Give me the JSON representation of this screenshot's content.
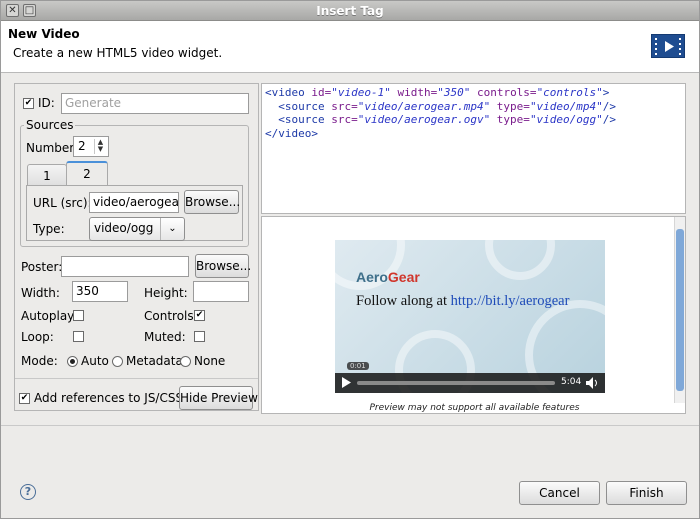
{
  "window": {
    "title": "Insert Tag"
  },
  "header": {
    "title": "New Video",
    "subtitle": "Create a new HTML5 video widget."
  },
  "form": {
    "id_label": "ID:",
    "id_placeholder": "Generate",
    "sources_label": "Sources",
    "number_label": "Number:",
    "number_value": "2",
    "tabs": [
      "1",
      "2"
    ],
    "url_label": "URL (src):",
    "url_value": "video/aerogear.og",
    "browse_label": "Browse...",
    "type_label": "Type:",
    "type_value": "video/ogg",
    "poster_label": "Poster:",
    "poster_browse_label": "Browse...",
    "width_label": "Width:",
    "width_value": "350",
    "height_label": "Height:",
    "height_value": "",
    "autoplay_label": "Autoplay:",
    "controls_label": "Controls:",
    "loop_label": "Loop:",
    "muted_label": "Muted:",
    "mode_label": "Mode:",
    "mode_options": [
      "Auto",
      "Metadata",
      "None"
    ],
    "add_refs_label": "Add references to JS/CSS",
    "hide_preview_label": "Hide Preview"
  },
  "code": {
    "l1": [
      "<video ",
      "id=",
      "\"video-1\"",
      " width=",
      "\"350\"",
      " controls=",
      "\"controls\"",
      ">"
    ],
    "l2": [
      "  <source ",
      "src=",
      "\"video/aerogear.mp4\"",
      " type=",
      "\"video/mp4\"",
      "/>"
    ],
    "l3": [
      "  <source ",
      "src=",
      "\"video/aerogear.ogv\"",
      " type=",
      "\"video/ogg\"",
      "/>"
    ],
    "l4": "</video>"
  },
  "preview": {
    "logo_a": "Aero",
    "logo_b": "Gear",
    "text": "Follow along at ",
    "link": "http://bit.ly/aerogear",
    "time_current": "0:01",
    "time_total": "5:04",
    "note": "Preview may not support all available features"
  },
  "footer": {
    "cancel_label": "Cancel",
    "finish_label": "Finish",
    "help": "?"
  }
}
